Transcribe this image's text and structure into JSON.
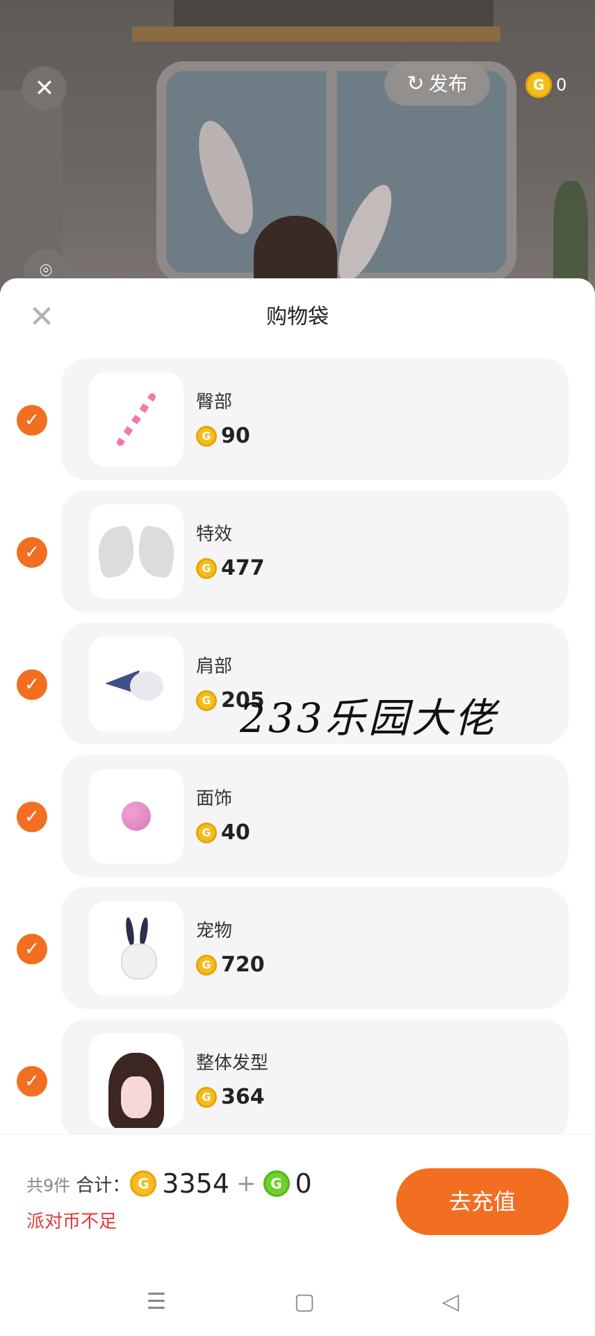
{
  "scene": {
    "close_icon": "close-icon",
    "publish_label": "发布",
    "coin_balance": "0",
    "camera_icon": "camera-icon"
  },
  "sheet": {
    "title": "购物袋",
    "items": [
      {
        "category": "臀部",
        "price": "90",
        "thumb": "tail"
      },
      {
        "category": "特效",
        "price": "477",
        "thumb": "wings"
      },
      {
        "category": "肩部",
        "price": "205",
        "thumb": "bat-pet"
      },
      {
        "category": "面饰",
        "price": "40",
        "thumb": "pink-ball"
      },
      {
        "category": "宠物",
        "price": "720",
        "thumb": "bunny"
      },
      {
        "category": "整体发型",
        "price": "364",
        "thumb": "hair"
      }
    ]
  },
  "watermark": "233乐园大佬",
  "footer": {
    "count_text": "共9件",
    "total_label": "合计：",
    "gold_total": "3354",
    "plus": "+",
    "green_total": "0",
    "warning": "派对币不足",
    "recharge_label": "去充值"
  },
  "colors": {
    "accent": "#f26e21",
    "warning": "#e53935",
    "coin_gold": "#f4bd1c",
    "coin_green": "#6fd02d"
  }
}
